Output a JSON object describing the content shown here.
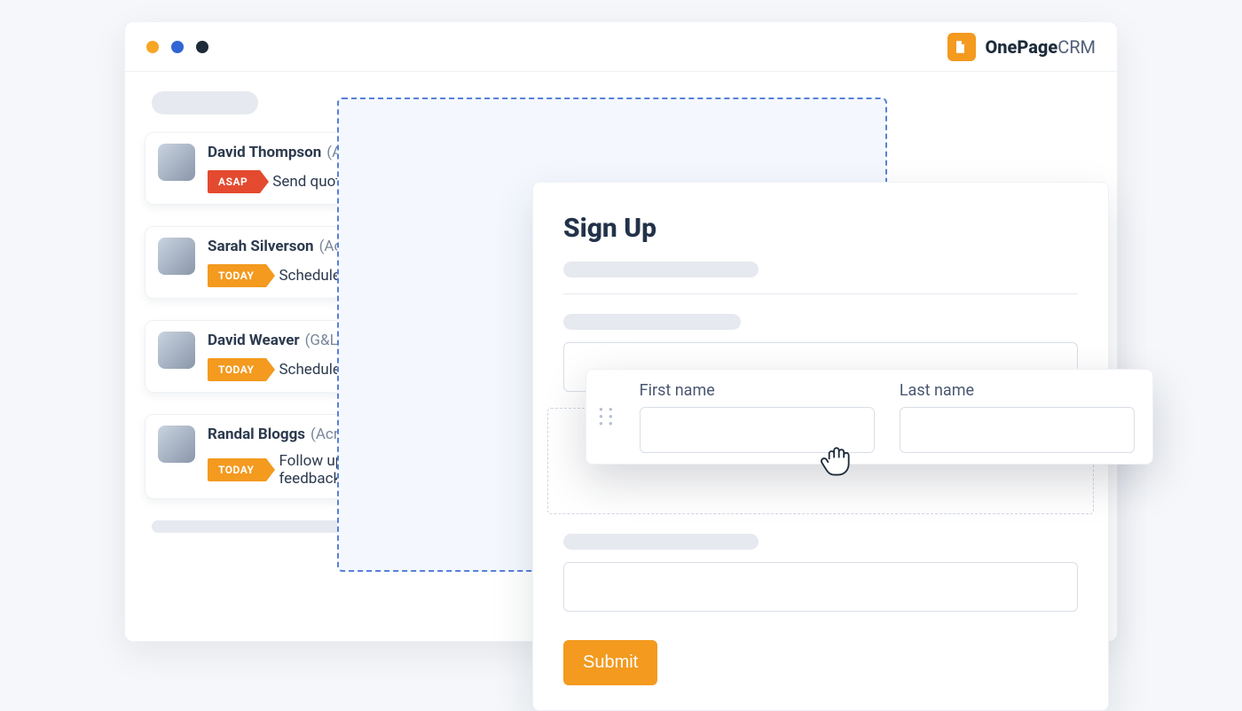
{
  "brand": {
    "bold": "OnePage",
    "light": "CRM"
  },
  "contacts": [
    {
      "name": "David Thompson",
      "company": "(Acme Inc.)",
      "flag": "ASAP",
      "flag_color": "red",
      "task": "Send quote"
    },
    {
      "name": "Sarah Silverson",
      "company": "(Acme Inc.)",
      "flag": "TODAY",
      "flag_color": "orange",
      "task": "Schedule a meeting"
    },
    {
      "name": "David Weaver",
      "company": "(G&L Ltd.)",
      "flag": "TODAY",
      "flag_color": "orange",
      "task": "Schedule a meeting"
    },
    {
      "name": "Randal Bloggs",
      "company": "(Acme Inc.)",
      "flag": "TODAY",
      "flag_color": "orange",
      "task": "Follow up re: feedback"
    }
  ],
  "signup": {
    "title": "Sign Up",
    "submit_label": "Submit"
  },
  "drag_fields": {
    "first_label": "First name",
    "last_label": "Last name"
  }
}
